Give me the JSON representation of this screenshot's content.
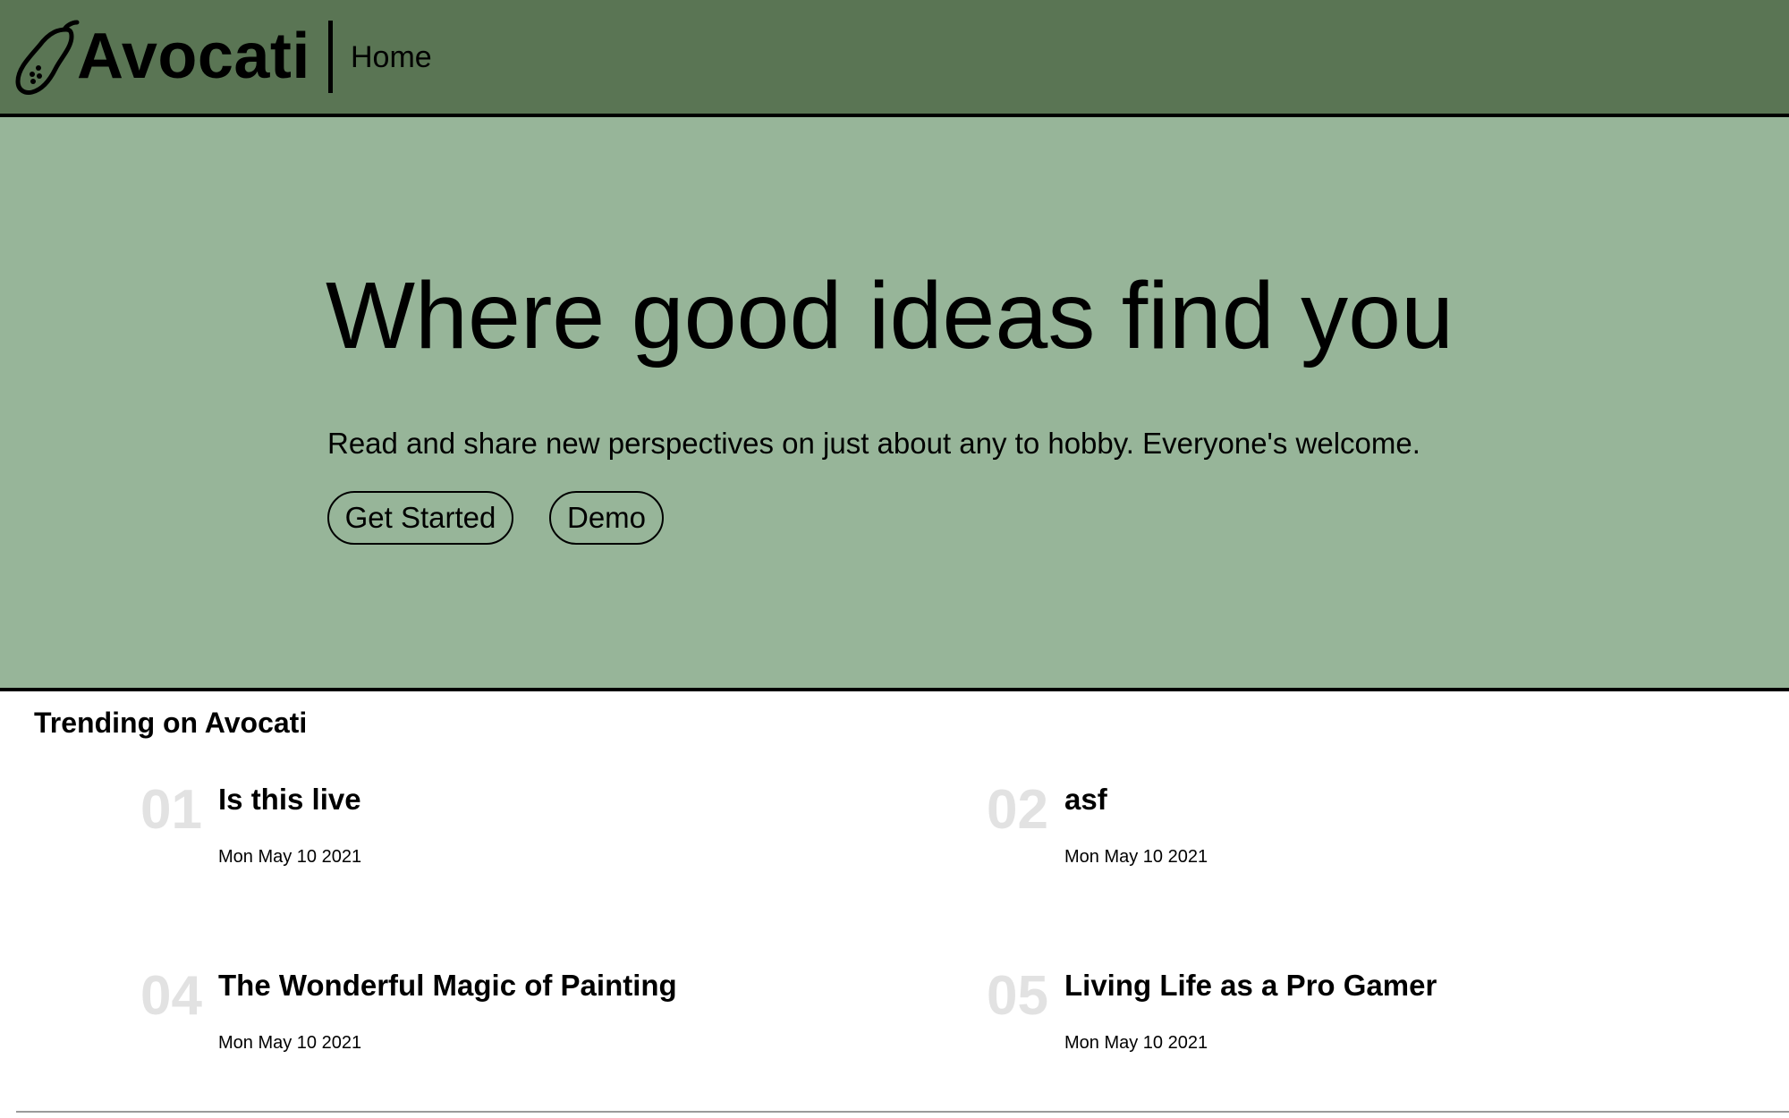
{
  "header": {
    "brand": "Avocati",
    "logo_icon": "avocado-icon",
    "nav": {
      "home_label": "Home"
    },
    "background_color": "#5a7554"
  },
  "hero": {
    "title": "Where good ideas find you",
    "subtitle": "Read and share new perspectives on just about any to hobby. Everyone's welcome.",
    "buttons": {
      "get_started_label": "Get Started",
      "demo_label": "Demo"
    },
    "background_color": "#97b599"
  },
  "trending": {
    "heading": "Trending on Avocati",
    "items": [
      {
        "number": "01",
        "title": "Is this live",
        "date": "Mon May 10 2021"
      },
      {
        "number": "02",
        "title": "asf",
        "date": "Mon May 10 2021"
      },
      {
        "number": "04",
        "title": "The Wonderful Magic of Painting",
        "date": "Mon May 10 2021"
      },
      {
        "number": "05",
        "title": "Living Life as a Pro Gamer",
        "date": "Mon May 10 2021"
      }
    ],
    "number_color": "#e2e2e2"
  }
}
